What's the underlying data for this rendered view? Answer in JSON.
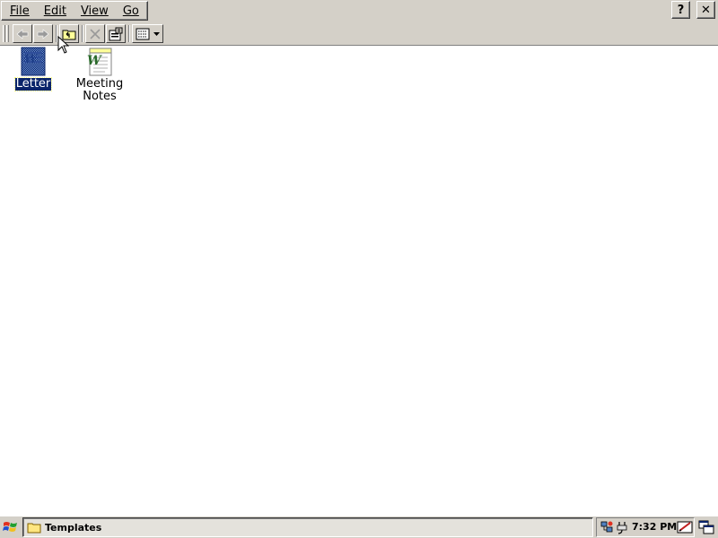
{
  "menu": {
    "file": "File",
    "edit": "Edit",
    "view": "View",
    "go": "Go"
  },
  "title_buttons": {
    "help": "?",
    "close": "✕"
  },
  "toolbar": {
    "back_icon": "back-arrow-icon",
    "forward_icon": "forward-arrow-icon",
    "up_icon": "up-folder-icon",
    "delete_icon": "delete-x-icon",
    "properties_icon": "properties-icon",
    "views_icon": "view-list-icon"
  },
  "files": [
    {
      "label": "Letter",
      "selected": true
    },
    {
      "label": "Meeting\nNotes",
      "selected": false
    }
  ],
  "taskbar": {
    "start_icon": "windows-logo-icon",
    "task_label": "Templates",
    "clock": "7:32 PM"
  },
  "colors": {
    "chrome": "#d4d0c8",
    "selection": "#0a246a"
  }
}
